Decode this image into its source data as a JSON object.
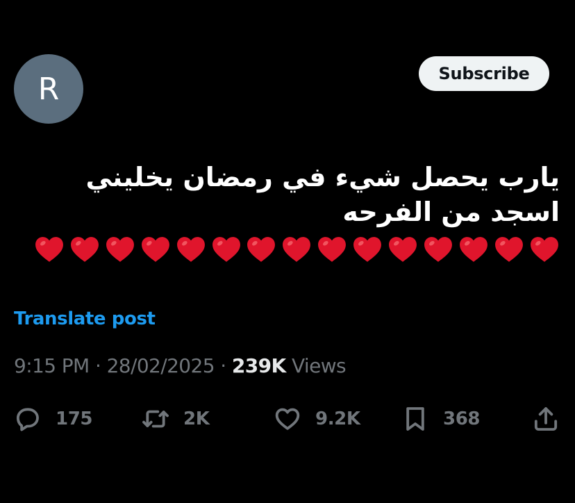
{
  "author": {
    "avatar_initial": "R"
  },
  "header": {
    "subscribe_label": "Subscribe"
  },
  "post": {
    "text": "يارب يحصل شيء في رمضان يخليني اسجد من الفرحه",
    "heart_emoji_count": 15,
    "heart_color": "#e0152c",
    "translate_label": "Translate post"
  },
  "meta": {
    "time": "9:15 PM",
    "separator": "·",
    "date": "28/02/2025",
    "views_count": "239K",
    "views_label": "Views"
  },
  "actions": {
    "replies": "175",
    "reposts": "2K",
    "likes": "9.2K",
    "bookmarks": "368"
  },
  "colors": {
    "background": "#000000",
    "link": "#1d9bf0",
    "muted": "#71767b",
    "text": "#e7e9ea",
    "avatar": "#5b6e7e"
  }
}
